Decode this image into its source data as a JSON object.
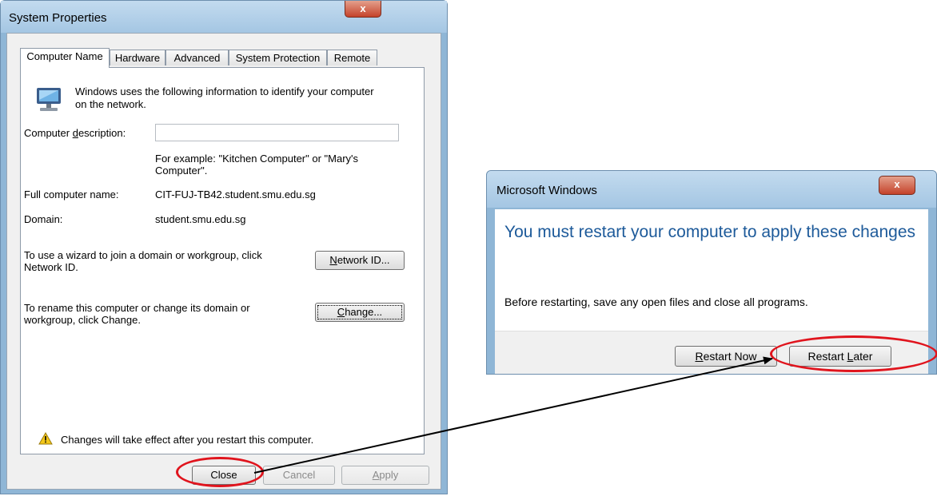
{
  "system_properties": {
    "title": "System Properties",
    "close_glyph": "x",
    "tabs": [
      {
        "label": "Computer Name",
        "active": true
      },
      {
        "label": "Hardware",
        "active": false
      },
      {
        "label": "Advanced",
        "active": false
      },
      {
        "label": "System Protection",
        "active": false
      },
      {
        "label": "Remote",
        "active": false
      }
    ],
    "intro_line1": "Windows uses the following information to identify your computer",
    "intro_line2": "on the network.",
    "description_label": {
      "before": "Computer ",
      "accel": "d",
      "after": "escription:"
    },
    "description_value": "",
    "example_line1": "For example: \"Kitchen Computer\" or \"Mary's",
    "example_line2": "Computer\".",
    "full_name_label": "Full computer name:",
    "full_name_value": "CIT-FUJ-TB42.student.smu.edu.sg",
    "domain_label": "Domain:",
    "domain_value": "student.smu.edu.sg",
    "wizard_line1": "To use a wizard to join a domain or workgroup, click",
    "wizard_line2": "Network ID.",
    "network_id_button": {
      "accel": "N",
      "rest": "etwork ID..."
    },
    "rename_line1": "To rename this computer or change its domain or",
    "rename_line2": "workgroup, click Change.",
    "change_button": {
      "accel": "C",
      "rest": "hange..."
    },
    "warning": "Changes will take effect after you restart this computer.",
    "buttons": {
      "close": "Close",
      "cancel": "Cancel",
      "apply": {
        "accel": "A",
        "rest": "pply"
      }
    }
  },
  "restart_dialog": {
    "title": "Microsoft Windows",
    "close_glyph": "x",
    "heading": "You must restart your computer to apply these changes",
    "message": "Before restarting, save any open files and close all programs.",
    "restart_now": {
      "accel": "R",
      "rest": "estart Now"
    },
    "restart_later": {
      "before": "Restart ",
      "accel": "L",
      "rest": "ater"
    }
  },
  "colors": {
    "highlight_oval": "#e0141d",
    "heading_blue": "#1d5a9a",
    "arrow": "#000000"
  },
  "icons": [
    "monitor-icon",
    "warning-icon",
    "close-icon"
  ]
}
